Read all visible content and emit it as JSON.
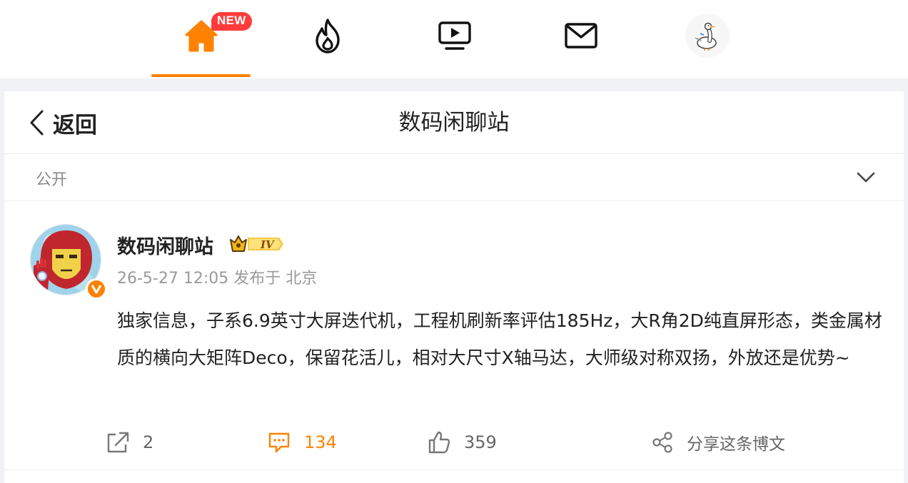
{
  "nav": {
    "items": [
      {
        "name": "home",
        "icon": "home-icon",
        "active": true
      },
      {
        "name": "hot",
        "icon": "flame-icon",
        "active": false
      },
      {
        "name": "video",
        "icon": "video-screen-icon",
        "active": false
      },
      {
        "name": "messages",
        "icon": "mail-icon",
        "active": false
      },
      {
        "name": "profile",
        "icon": "goose-avatar-icon",
        "active": false
      }
    ],
    "new_badge": "NEW",
    "accent_color": "#ff8200"
  },
  "header": {
    "back_label": "返回",
    "title": "数码闲聊站"
  },
  "visibility": {
    "label": "公开"
  },
  "post": {
    "username": "数码闲聊站",
    "level_badge": "IV",
    "meta": "26-5-27 12:05  发布于 北京",
    "text": "独家信息，子系6.9英寸大屏迭代机，工程机刷新率评估185Hz，大R角2D纯直屏形态，类金属材质的横向大矩阵Deco，保留花活儿，相对大尺寸X轴马达，大师级对称双扬，外放还是优势~"
  },
  "actions": {
    "repost_count": "2",
    "comment_count": "134",
    "like_count": "359",
    "share_label": "分享这条博文"
  }
}
